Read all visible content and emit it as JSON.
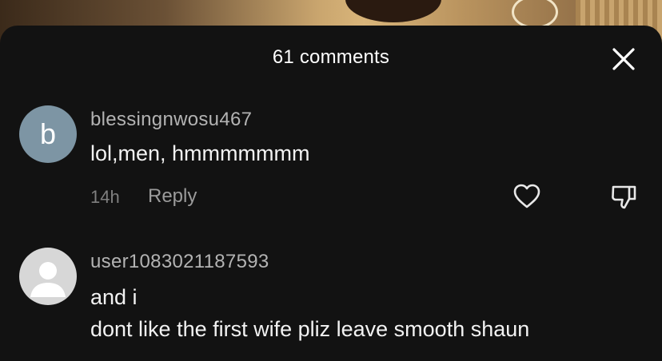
{
  "sheet": {
    "title": "61 comments",
    "close_icon": "close-icon"
  },
  "comments": [
    {
      "avatar_letter": "b",
      "avatar_color": "#7d95a4",
      "username": "blessingnwosu467",
      "text_lines": [
        "lol,men, hmmmmmmm"
      ],
      "time": "14h",
      "reply_label": "Reply",
      "like_icon": "heart-icon",
      "dislike_icon": "thumbs-down-icon"
    },
    {
      "avatar_icon": "default-avatar-icon",
      "username": "user1083021187593",
      "text_lines": [
        "and i",
        "dont like the first wife pliz leave smooth shaun"
      ]
    }
  ],
  "colors": {
    "sheet_bg": "#121212",
    "username": "#b3b3b3",
    "text": "#f2f2f2",
    "meta": "#7f7f7f"
  }
}
